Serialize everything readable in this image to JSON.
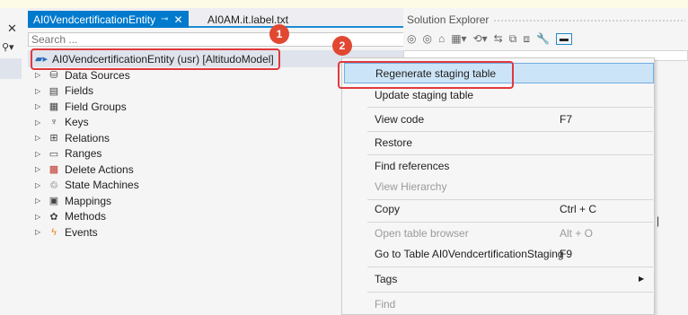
{
  "editor": {
    "tabs": [
      {
        "label": "AI0VendcertificationEntity",
        "pin": "⊸",
        "close": "✕"
      },
      {
        "label": "AI0AM.it.label.txt"
      }
    ],
    "search_placeholder": "Search ...",
    "tree": {
      "root_label": "AI0VendcertificationEntity (usr) [AltitudoModel]",
      "items": [
        {
          "label": "Data Sources",
          "icon": "database-icon",
          "glyph": "⛁"
        },
        {
          "label": "Fields",
          "icon": "fields-icon",
          "glyph": "▤"
        },
        {
          "label": "Field Groups",
          "icon": "field-groups-icon",
          "glyph": "▦"
        },
        {
          "label": "Keys",
          "icon": "keys-icon",
          "glyph": "♆"
        },
        {
          "label": "Relations",
          "icon": "relations-icon",
          "glyph": "⊞"
        },
        {
          "label": "Ranges",
          "icon": "ranges-icon",
          "glyph": "▭"
        },
        {
          "label": "Delete Actions",
          "icon": "delete-actions-icon",
          "glyph": "▩"
        },
        {
          "label": "State Machines",
          "icon": "state-machines-icon",
          "glyph": "♲"
        },
        {
          "label": "Mappings",
          "icon": "mappings-icon",
          "glyph": "▣"
        },
        {
          "label": "Methods",
          "icon": "methods-icon",
          "glyph": "✿"
        },
        {
          "label": "Events",
          "icon": "events-icon",
          "glyph": "ϟ"
        }
      ]
    }
  },
  "solution_explorer": {
    "title": "Solution Explorer"
  },
  "callouts": {
    "badge1": "1",
    "badge2": "2"
  },
  "context_menu": {
    "items": [
      {
        "label": "Regenerate staging table",
        "shortcut": "",
        "state": "hover"
      },
      {
        "label": "Update staging table",
        "shortcut": ""
      },
      {
        "label": "View code",
        "shortcut": "F7"
      },
      {
        "label": "Restore",
        "shortcut": ""
      },
      {
        "label": "Find references",
        "shortcut": ""
      },
      {
        "label": "View Hierarchy",
        "shortcut": "",
        "state": "disabled"
      },
      {
        "label": "Copy",
        "shortcut": "Ctrl + C"
      },
      {
        "label": "Open table browser",
        "shortcut": "Alt + O",
        "state": "disabled"
      },
      {
        "label": "Go to Table AI0VendcertificationStaging",
        "shortcut": "F9"
      },
      {
        "label": "Tags",
        "shortcut": "",
        "submenu": true
      },
      {
        "label": "Find",
        "shortcut": "",
        "state": "disabled"
      }
    ]
  },
  "colors": {
    "accent": "#007acc",
    "callout": "#e0393e",
    "hover": "#cce4f7"
  }
}
